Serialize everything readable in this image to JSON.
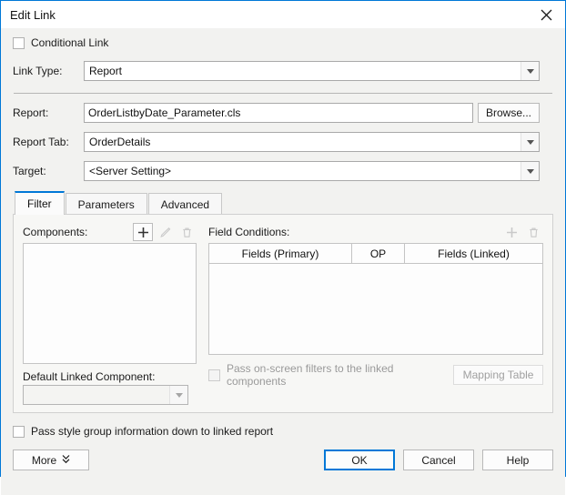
{
  "window": {
    "title": "Edit Link",
    "close_icon": "close-icon"
  },
  "conditional_link": {
    "label": "Conditional Link",
    "checked": false
  },
  "link_type": {
    "label": "Link Type:",
    "value": "Report"
  },
  "report": {
    "label": "Report:",
    "value": "OrderListbyDate_Parameter.cls",
    "browse_label": "Browse..."
  },
  "report_tab": {
    "label": "Report Tab:",
    "value": "OrderDetails"
  },
  "target": {
    "label": "Target:",
    "value": "<Server Setting>"
  },
  "tabs": [
    {
      "label": "Filter",
      "active": true
    },
    {
      "label": "Parameters",
      "active": false
    },
    {
      "label": "Advanced",
      "active": false
    }
  ],
  "components": {
    "label": "Components:",
    "items": [],
    "tools": [
      {
        "name": "add-icon",
        "enabled": true
      },
      {
        "name": "edit-pencil-icon",
        "enabled": false
      },
      {
        "name": "delete-trash-icon",
        "enabled": false
      }
    ]
  },
  "default_linked_component": {
    "label": "Default Linked Component:",
    "value": ""
  },
  "field_conditions": {
    "label": "Field Conditions:",
    "columns": [
      "Fields (Primary)",
      "OP",
      "Fields (Linked)"
    ],
    "rows": [],
    "tools": [
      {
        "name": "add-icon",
        "enabled": false
      },
      {
        "name": "delete-trash-icon",
        "enabled": false
      }
    ]
  },
  "pass_onscreen_filters": {
    "label": "Pass on-screen filters to the linked components",
    "checked": false,
    "disabled": true
  },
  "mapping_table": {
    "label": "Mapping Table",
    "disabled": true
  },
  "pass_style_group": {
    "label": "Pass style group information down to linked report",
    "checked": false
  },
  "footer": {
    "more_label": "More",
    "more_chevron": "chevron-double-down-icon",
    "ok_label": "OK",
    "cancel_label": "Cancel",
    "help_label": "Help"
  },
  "colors": {
    "accent": "#0078d7",
    "dialog_bg": "#f2f2f0",
    "panel_bg": "#f7f7f5"
  }
}
